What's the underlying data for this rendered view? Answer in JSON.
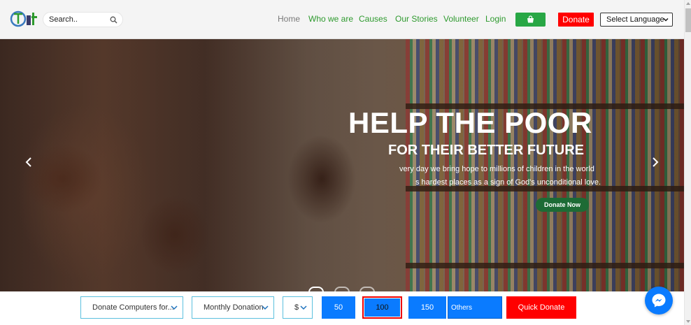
{
  "header": {
    "search_placeholder": "Search..",
    "nav": [
      {
        "label": "Home"
      },
      {
        "label": "Who we are"
      },
      {
        "label": "Causes"
      },
      {
        "label": "Our Stories"
      },
      {
        "label": "Volunteer"
      },
      {
        "label": "Login"
      }
    ],
    "donate_label": "Donate",
    "language_label": "Select Language"
  },
  "hero": {
    "title": "HELP THE POOR",
    "subtitle": "FOR THEIR BETTER FUTURE",
    "line1": "very day we bring hope to millions of children in the world",
    "line2": "s hardest places as a sign of God's unconditional love.",
    "cta": "Donate Now"
  },
  "donation_bar": {
    "campaign": "Donate Computers for...",
    "frequency": "Monthly Donation",
    "currency": "$",
    "amounts": [
      "50",
      "100",
      "150"
    ],
    "selected_amount": "100",
    "others_label": "Others",
    "quick_donate_label": "Quick Donate"
  },
  "colors": {
    "nav_green": "#2e9a2e",
    "cart_green": "#28a745",
    "donate_red": "#ff0000",
    "amount_blue": "#0a7bff",
    "cta_green": "#1d6b35"
  }
}
